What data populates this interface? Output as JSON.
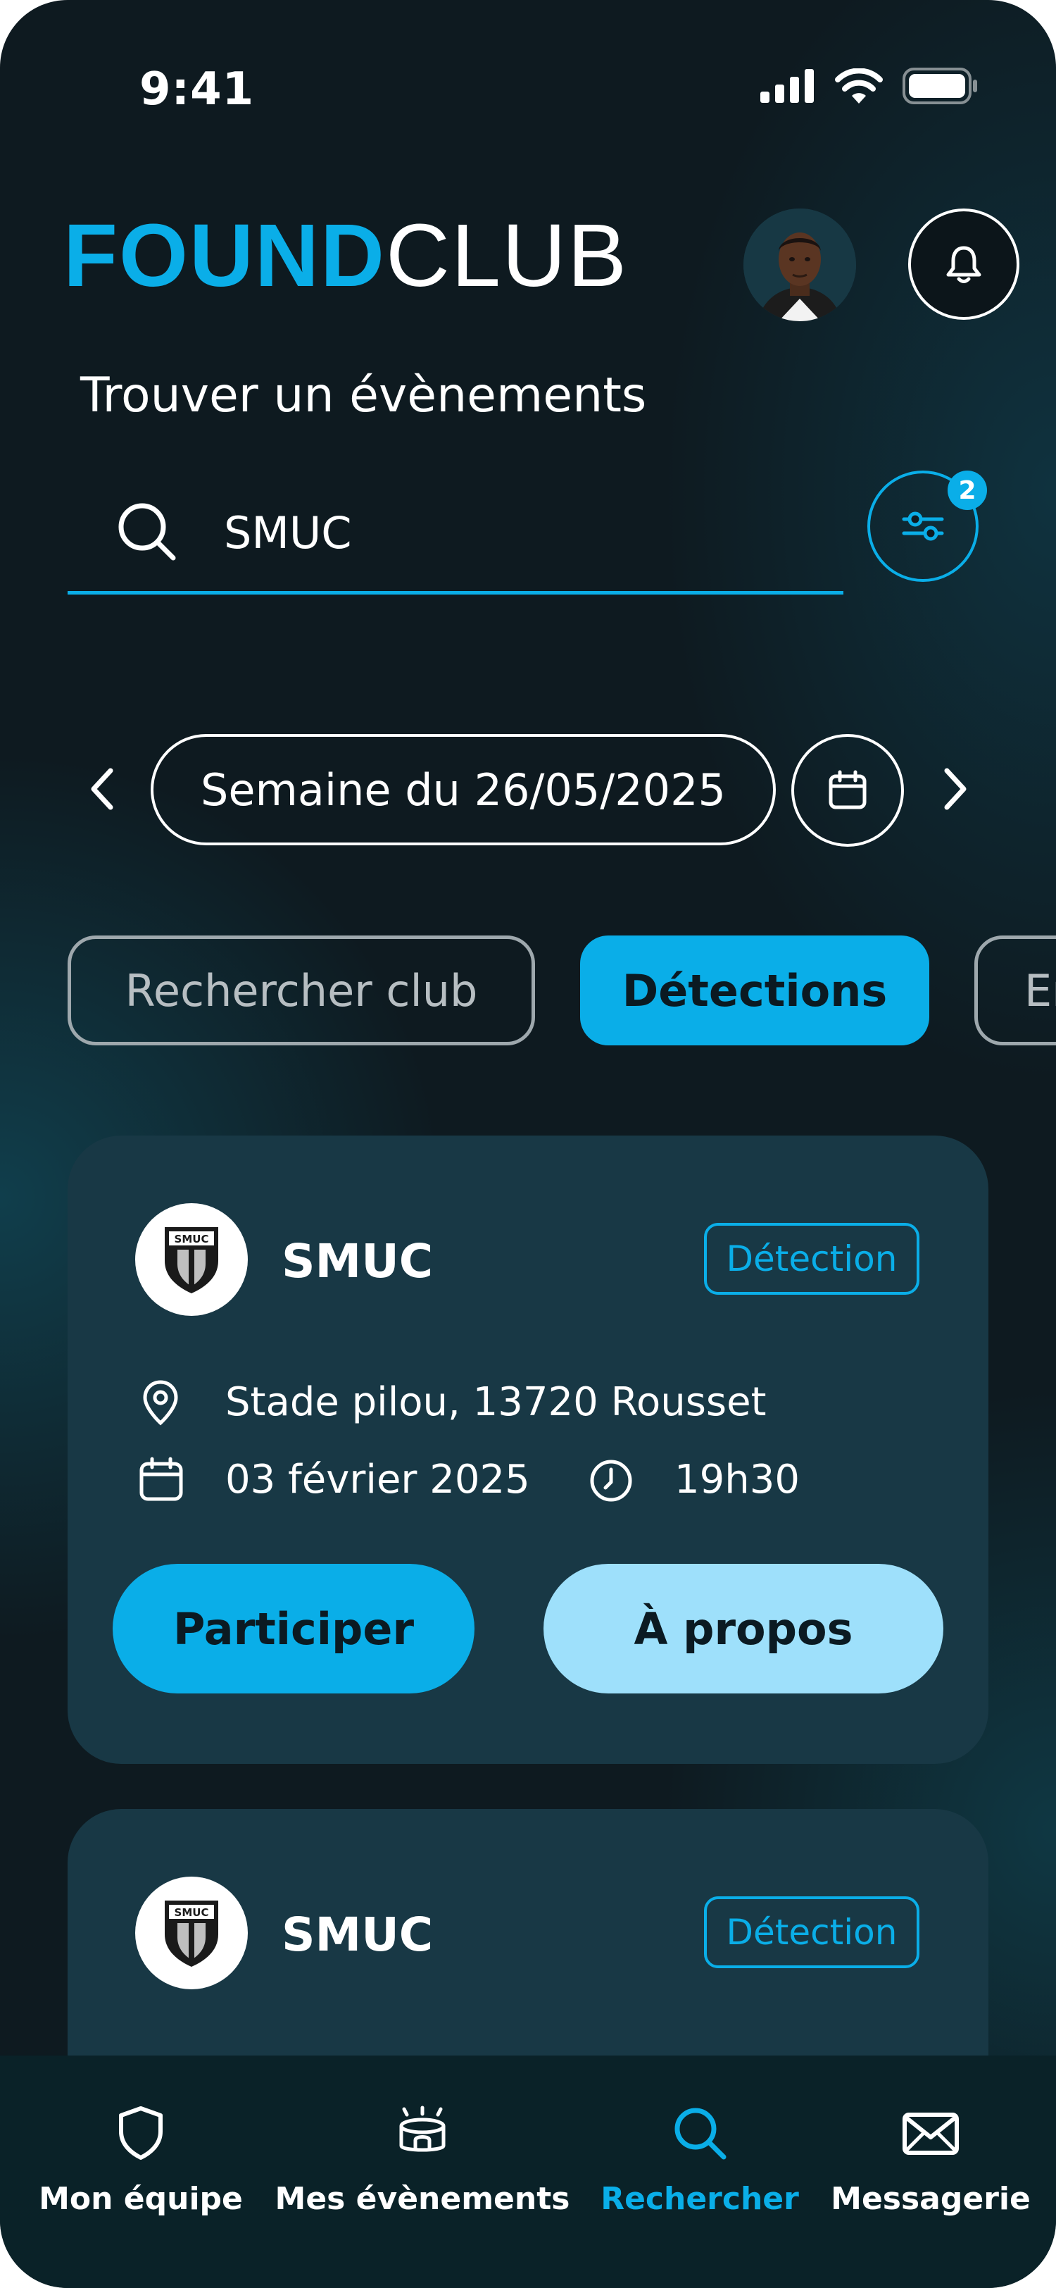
{
  "status_bar": {
    "time": "9:41"
  },
  "header": {
    "logo_part1": "FOUND",
    "logo_part2": "CLUB"
  },
  "page_title": "Trouver un évènements",
  "search": {
    "value": "SMUC",
    "filter_count": "2"
  },
  "week_selector": {
    "label": "Semaine du 26/05/2025"
  },
  "chips": [
    {
      "label": "Rechercher club",
      "active": false
    },
    {
      "label": "Détections",
      "active": true
    },
    {
      "label": "En",
      "active": false
    }
  ],
  "events": [
    {
      "club": "SMUC",
      "badge": "SMUC",
      "tag": "Détection",
      "location": "Stade pilou, 13720 Rousset",
      "date": "03 février 2025",
      "time": "19h30",
      "primary_action": "Participer",
      "secondary_action": "À propos"
    },
    {
      "club": "SMUC",
      "badge": "SMUC",
      "tag": "Détection"
    }
  ],
  "bottom_nav": [
    {
      "label": "Mon équipe",
      "icon": "shield-icon",
      "active": false
    },
    {
      "label": "Mes évènements",
      "icon": "stadium-icon",
      "active": false
    },
    {
      "label": "Rechercher",
      "icon": "search-icon",
      "active": true
    },
    {
      "label": "Messagerie",
      "icon": "mail-icon",
      "active": false
    }
  ],
  "colors": {
    "accent": "#0aaee8",
    "card": "#183845",
    "light_accent": "#9ee0fb",
    "background": "#0e1a20"
  }
}
